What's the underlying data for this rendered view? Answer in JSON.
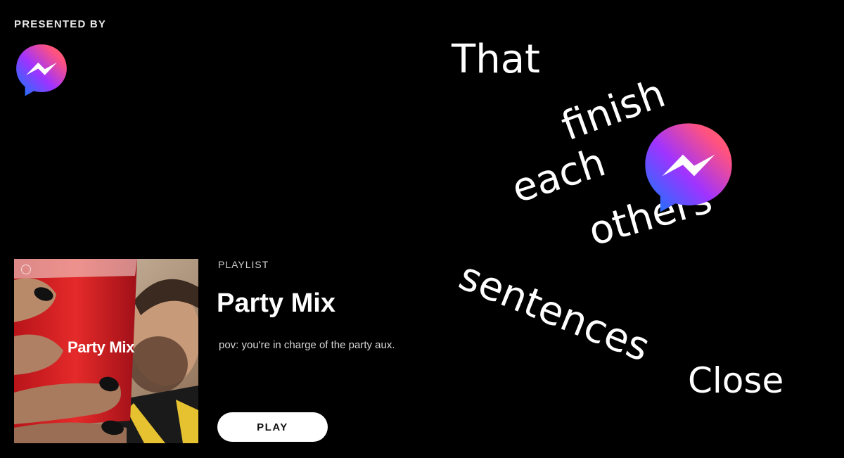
{
  "sponsor": {
    "presented_by_label": "PRESENTED BY",
    "logo_icon": "messenger-icon",
    "gradient_colors": [
      "#0A7CFF",
      "#A033FF",
      "#FF5280",
      "#FF7061"
    ]
  },
  "playlist": {
    "cover_title": "Party Mix",
    "type_label": "PLAYLIST",
    "title": "Party Mix",
    "description": "pov: you're in charge of the party aux.",
    "play_label": "PLAY"
  },
  "tagline": {
    "words": [
      "That",
      "finish",
      "each",
      "others",
      "sentences"
    ],
    "logo_icon": "messenger-icon"
  },
  "close_label": "Close"
}
